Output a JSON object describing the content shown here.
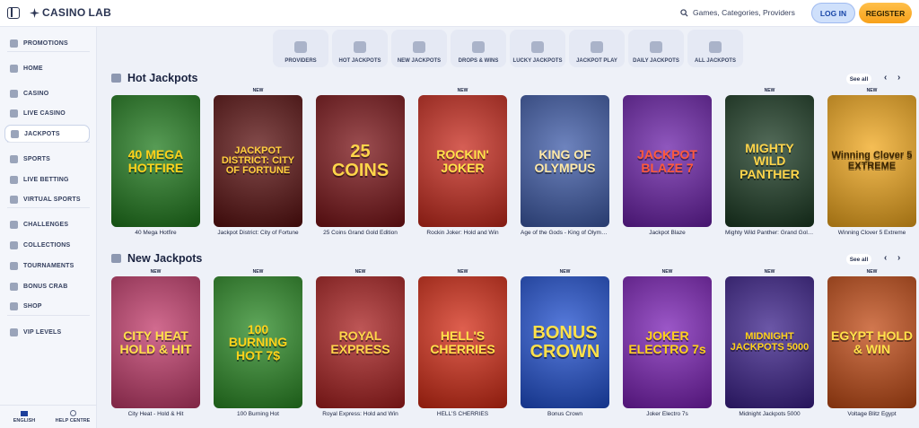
{
  "header": {
    "logo_prefix": "CASINO",
    "logo_suffix": "LAB",
    "search_placeholder": "Games, Categories, Providers",
    "login": "LOG IN",
    "register": "REGISTER"
  },
  "sidebar": {
    "items": [
      {
        "label": "PROMOTIONS",
        "icon": "gift-icon"
      },
      {
        "label": "HOME",
        "icon": "home-icon"
      },
      {
        "label": "CASINO",
        "icon": "casino-chip-icon"
      },
      {
        "label": "LIVE CASINO",
        "icon": "live-icon"
      },
      {
        "label": "JACKPOTS",
        "icon": "jackpot-icon"
      },
      {
        "label": "SPORTS",
        "icon": "ball-icon"
      },
      {
        "label": "LIVE BETTING",
        "icon": "live-betting-icon"
      },
      {
        "label": "VIRTUAL SPORTS",
        "icon": "virtual-sports-icon"
      },
      {
        "label": "CHALLENGES",
        "icon": "challenges-icon"
      },
      {
        "label": "COLLECTIONS",
        "icon": "collections-icon"
      },
      {
        "label": "TOURNAMENTS",
        "icon": "trophy-icon"
      },
      {
        "label": "BONUS CRAB",
        "icon": "crab-icon"
      },
      {
        "label": "SHOP",
        "icon": "shop-icon"
      },
      {
        "label": "VIP LEVELS",
        "icon": "vip-icon"
      }
    ],
    "active": "JACKPOTS",
    "footer": {
      "language": "ENGLISH",
      "help": "HELP CENTRE"
    }
  },
  "categories": [
    "PROVIDERS",
    "HOT JACKPOTS",
    "NEW JACKPOTS",
    "DROPS & WINS",
    "LUCKY JACKPOTS",
    "JACKPOT PLAY",
    "DAILY JACKPOTS",
    "ALL JACKPOTS"
  ],
  "sections": [
    {
      "title": "Hot Jackpots",
      "see_all": "See all",
      "games": [
        {
          "title": "40 Mega Hotfire",
          "art": "40 MEGA HOTFIRE",
          "badge": "",
          "bg": "#1f7a1c",
          "fg": "#ffd21a"
        },
        {
          "title": "Jackpot District: City of Fortune",
          "art": "JACKPOT DISTRICT: CITY OF FORTUNE",
          "badge": "NEW",
          "bg": "#5a0f0f",
          "fg": "#ffcf3d"
        },
        {
          "title": "25 Coins Grand Gold Edition",
          "art": "25 COINS",
          "badge": "",
          "bg": "#7a1216",
          "fg": "#ffd54a"
        },
        {
          "title": "Rockin Joker: Hold and Win",
          "art": "ROCKIN' JOKER",
          "badge": "NEW",
          "bg": "#c8291c",
          "fg": "#ffe14a"
        },
        {
          "title": "Age of the Gods - King of Olympus",
          "art": "KING OF OLYMPUS",
          "badge": "",
          "bg": "#3d5aa8",
          "fg": "#ffe9a8"
        },
        {
          "title": "Jackpot Blaze",
          "art": "JACKPOT BLAZE 7",
          "badge": "",
          "bg": "#6a1fa8",
          "fg": "#ff5a3a"
        },
        {
          "title": "Mighty Wild Panther: Grand Gold Edition",
          "art": "MIGHTY WILD PANTHER",
          "badge": "NEW",
          "bg": "#1a3a22",
          "fg": "#ffd54a"
        },
        {
          "title": "Winning Clover 5 Extreme",
          "art": "Winning Clover 5 EXTREME",
          "badge": "NEW",
          "bg": "#f2a81c",
          "fg": "#3a2400"
        }
      ]
    },
    {
      "title": "New Jackpots",
      "see_all": "See all",
      "games": [
        {
          "title": "City Heat - Hold & Hit",
          "art": "CITY HEAT HOLD & HIT",
          "badge": "NEW",
          "bg": "#c23a6a",
          "fg": "#ffe14a"
        },
        {
          "title": "100 Burning Hot",
          "art": "100 BURNING HOT 7$",
          "badge": "NEW",
          "bg": "#2a8a24",
          "fg": "#ffd21a"
        },
        {
          "title": "Royal Express: Hold and Win",
          "art": "ROYAL EXPRESS",
          "badge": "NEW",
          "bg": "#a81e1e",
          "fg": "#ffd54a"
        },
        {
          "title": "HELL'S CHERRIES",
          "art": "HELL'S CHERRIES",
          "badge": "NEW",
          "bg": "#d42a14",
          "fg": "#ffe14a"
        },
        {
          "title": "Bonus Crown",
          "art": "BONUS CROWN",
          "badge": "NEW",
          "bg": "#1f4fd1",
          "fg": "#ffe14a"
        },
        {
          "title": "Joker Electro 7s",
          "art": "JOKER ELECTRO 7s",
          "badge": "NEW",
          "bg": "#7a1fb5",
          "fg": "#ffd21a"
        },
        {
          "title": "Midnight Jackpots 5000",
          "art": "MIDNIGHT JACKPOTS 5000",
          "badge": "NEW",
          "bg": "#3a1f8a",
          "fg": "#ffd21a"
        },
        {
          "title": "Voltage Blitz Egypt",
          "art": "EGYPT HOLD & WIN",
          "badge": "NEW",
          "bg": "#c24a14",
          "fg": "#ffe14a"
        }
      ]
    }
  ]
}
